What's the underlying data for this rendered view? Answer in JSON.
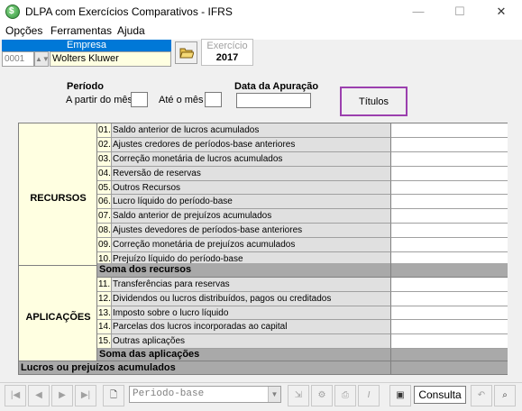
{
  "window": {
    "title": "DLPA com Exercícios Comparativos - IFRS",
    "icon": "app-globe-icon",
    "minimize_glyph": "—",
    "maximize_glyph": "☐",
    "close_glyph": "✕"
  },
  "menu": [
    {
      "label": "Opções"
    },
    {
      "label": "Ferramentas"
    },
    {
      "label": "Ajuda"
    }
  ],
  "empresa": {
    "label": "Empresa",
    "code": "0001",
    "name": "Wolters Kluwer"
  },
  "exercicio": {
    "label": "Exercício",
    "value": "2017"
  },
  "periodo": {
    "label": "Período",
    "from_label": "A partir do mês",
    "to_label": "Até o mês",
    "from_value": "",
    "to_value": ""
  },
  "apuracao": {
    "label": "Data da Apuração",
    "value": ""
  },
  "titulos_button": "Títulos",
  "table": {
    "groups": [
      {
        "label": "RECURSOS",
        "rows": [
          {
            "num": "01.",
            "desc": "Saldo anterior de lucros acumulados",
            "value": ""
          },
          {
            "num": "02.",
            "desc": "Ajustes credores de períodos-base anteriores",
            "value": ""
          },
          {
            "num": "03.",
            "desc": "Correção monetária de lucros acumulados",
            "value": ""
          },
          {
            "num": "04.",
            "desc": "Reversão de reservas",
            "value": ""
          },
          {
            "num": "05.",
            "desc": "Outros Recursos",
            "value": ""
          },
          {
            "num": "06.",
            "desc": "Lucro líquido do período-base",
            "value": ""
          },
          {
            "num": "07.",
            "desc": "Saldo anterior de prejuízos acumulados",
            "value": ""
          },
          {
            "num": "08.",
            "desc": "Ajustes devedores de períodos-base anteriores",
            "value": ""
          },
          {
            "num": "09.",
            "desc": "Correção monetária de prejuízos acumulados",
            "value": ""
          },
          {
            "num": "10.",
            "desc": "Prejuízo líquido do período-base",
            "value": ""
          }
        ],
        "sum_label": "Soma dos recursos",
        "sum_value": ""
      },
      {
        "label": "APLICAÇÕES",
        "rows": [
          {
            "num": "11.",
            "desc": "Transferências para reservas",
            "value": ""
          },
          {
            "num": "12.",
            "desc": "Dividendos ou lucros distribuídos, pagos ou creditados",
            "value": ""
          },
          {
            "num": "13.",
            "desc": "Imposto sobre o lucro líquido",
            "value": ""
          },
          {
            "num": "14.",
            "desc": "Parcelas dos lucros incorporadas ao capital",
            "value": ""
          },
          {
            "num": "15.",
            "desc": "Outras aplicações",
            "value": ""
          }
        ],
        "sum_label": "Soma das aplicações",
        "sum_value": ""
      }
    ],
    "total_label": "Lucros ou prejuízos acumulados",
    "total_value": ""
  },
  "toolbar": {
    "period_combo": "Periodo-base",
    "mode": "Consulta"
  }
}
